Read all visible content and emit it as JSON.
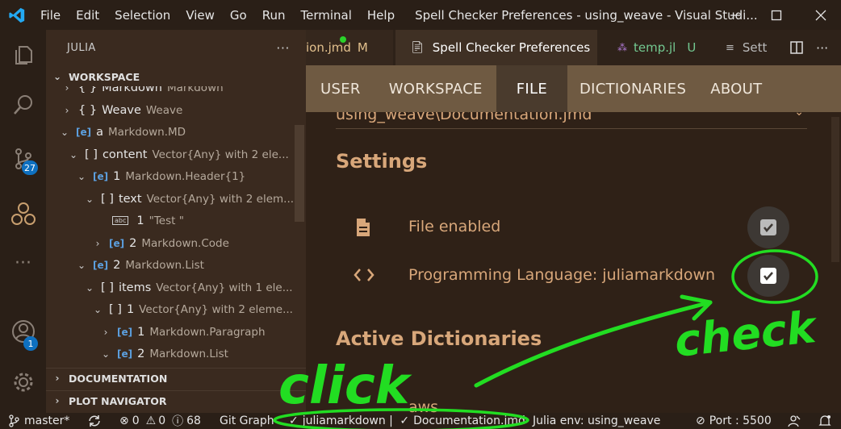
{
  "titlebar": {
    "menus": [
      "File",
      "Edit",
      "Selection",
      "View",
      "Go",
      "Run",
      "Terminal",
      "Help"
    ],
    "window_title": "Spell Checker Preferences - using_weave - Visual Studi..."
  },
  "activity": {
    "scm_badge": "27",
    "account_badge": "1"
  },
  "sidebar": {
    "title": "JULIA",
    "more": "···",
    "workspace_header": "WORKSPACE",
    "rows": [
      {
        "name": "Markdown",
        "type": "Markdown",
        "sym": "{ }"
      },
      {
        "name": "Weave",
        "type": "Weave",
        "sym": "{ }"
      },
      {
        "name": "a",
        "type": "Markdown.MD",
        "sym": "[e]"
      },
      {
        "name": "content",
        "type": "Vector{Any} with 2 ele...",
        "sym": "[ ]"
      },
      {
        "name": "1",
        "type": "Markdown.Header{1}",
        "sym": "[e]"
      },
      {
        "name": "text",
        "type": "Vector{Any} with 2 elem...",
        "sym": "[ ]"
      },
      {
        "name": "1",
        "type": "\"Test \"",
        "sym": "abc"
      },
      {
        "name": "2",
        "type": "Markdown.Code",
        "sym": "[e]"
      },
      {
        "name": "2",
        "type": "Markdown.List",
        "sym": "[e]"
      },
      {
        "name": "items",
        "type": "Vector{Any} with 1 ele...",
        "sym": "[ ]"
      },
      {
        "name": "1",
        "type": "Vector{Any} with 2 eleme...",
        "sym": "[ ]"
      },
      {
        "name": "1",
        "type": "Markdown.Paragraph",
        "sym": "[e]"
      },
      {
        "name": "2",
        "type": "Markdown.List",
        "sym": "[e]"
      }
    ],
    "documentation_header": "DOCUMENTATION",
    "plot_navigator_header": "PLOT NAVIGATOR"
  },
  "tabs": {
    "tab1": "ion.jmd",
    "tab1_status": "M",
    "tab2": "Spell Checker Preferences",
    "tab3": "temp.jl",
    "tab3_status": "U",
    "tab4": "Sett"
  },
  "webview": {
    "nav": [
      "USER",
      "WORKSPACE",
      "FILE",
      "DICTIONARIES",
      "ABOUT"
    ],
    "file_select": "using_weave\\Documentation.jmd",
    "settings_heading": "Settings",
    "file_enabled": "File enabled",
    "prog_lang": "Programming Language: juliamarkdown",
    "active_dicts": "Active Dictionaries",
    "aws": "aws"
  },
  "status": {
    "branch": "master*",
    "errors": "0",
    "warnings": "0",
    "info": "68",
    "gitgraph": "Git Graph",
    "lang_item": "juliamarkdown | ",
    "doc_item": "Documentation.jmd",
    "julia_env": "Julia env: using_weave",
    "port": "Port : 5500"
  },
  "annotations": {
    "click": "click",
    "check": "check",
    "color": "#22dd22"
  }
}
